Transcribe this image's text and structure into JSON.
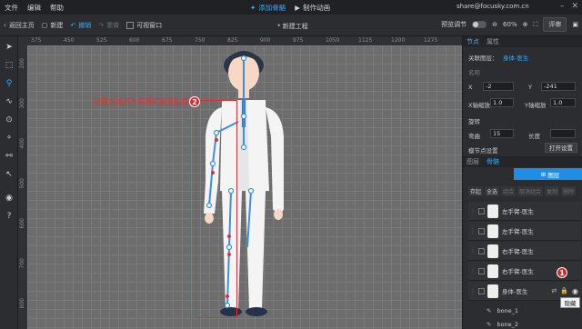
{
  "menu": {
    "file": "文件",
    "edit": "编辑",
    "help": "帮助"
  },
  "mode_tabs": {
    "add_bone": "添加骨骼",
    "make_animation": "制作动画"
  },
  "account": "share@focusky.com.cn",
  "toolbar": {
    "home": "返回主页",
    "new": "新建",
    "undo": "撤销",
    "redo": "重做",
    "visible_window": "可视窗口",
    "doc_title": "* 新建工程",
    "preview_adjust": "预览调节",
    "zoom": "60%",
    "run": "评审"
  },
  "ruler_top": [
    "375",
    "450",
    "525",
    "600",
    "675",
    "750",
    "825",
    "900",
    "975",
    "1050",
    "1125",
    "1200",
    "1275"
  ],
  "ruler_left": [
    "200",
    "300",
    "400",
    "500",
    "600",
    "700",
    "800"
  ],
  "annotation": {
    "text": "隐藏身体后为手臂和腿添加骨骼",
    "badge_2": "2",
    "badge_1": "1"
  },
  "props": {
    "tabs": [
      "节点",
      "属性"
    ],
    "related_layer_label": "关联图层：",
    "related_layer_value": "身体-医生",
    "name_label": "名称",
    "x_label": "X",
    "x_value": "-2",
    "y_label": "Y",
    "y_value": "-241",
    "xscale_label": "X轴缩放",
    "xscale_value": "1.0",
    "yscale_label": "Y轴缩放",
    "yscale_value": "1.0",
    "rotate_label": "旋转",
    "bend_label": "弯曲",
    "bend_value": "15",
    "length_label": "长度",
    "node_settings_label": "模节点设置",
    "open_settings": "打开设置"
  },
  "layers": {
    "tabs": [
      "图层",
      "骨骼"
    ],
    "add_layer": "图层",
    "ops": [
      "存起",
      "全选",
      "组合",
      "取消组合",
      "复制",
      "删除"
    ],
    "rows": [
      "左手臂-医生",
      "左手臂-医生",
      "右手臂-医生",
      "右手臂-医生",
      "身体-医生"
    ],
    "bones": [
      "bone_1",
      "bone_2"
    ],
    "tooltip": "隐藏"
  }
}
